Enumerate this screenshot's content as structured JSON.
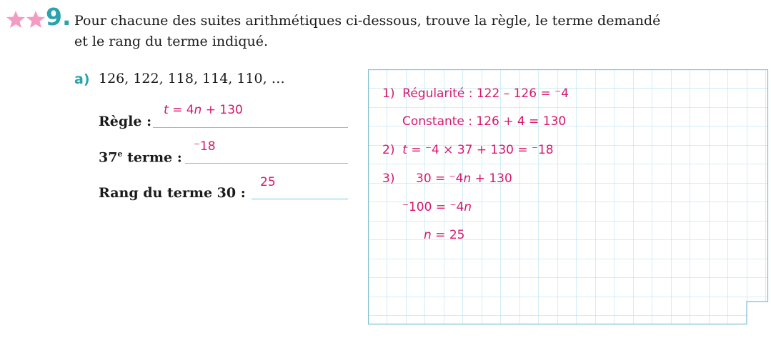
{
  "exercise": {
    "number": "9.",
    "difficulty_stars": 2,
    "star_color": "#f49bc3",
    "accent_color": "#2aa3ad",
    "instruction_line1": "Pour chacune des suites arithmétiques ci-dessous, trouve la règle, le terme demandé",
    "instruction_line2": "et le rang du terme indiqué."
  },
  "part_a": {
    "label": "a)",
    "sequence": "126, 122, 118, 114, 110, …",
    "rule_label": "Règle :",
    "rule_answer": {
      "t": "t",
      "eq": " = 4",
      "n": "n",
      "rest": " + 130"
    },
    "term_label_num": "37",
    "term_label_sup": "e",
    "term_label_rest": " terme :",
    "term_answer": "⁻18",
    "rank_label": "Rang du terme 30 :",
    "rank_answer": "25"
  },
  "work": {
    "line1_num": "1)",
    "line1_text": "Régularité : 122 – 126 = ⁻4",
    "line2_text": "Constante : 126 + 4 = 130",
    "line3_num": "2)",
    "line3_t": "t",
    "line3_rest": " = ⁻4 × 37 + 130 = ⁻18",
    "line4_num": "3)",
    "line4_a": "30 = ⁻4",
    "line4_n": "n",
    "line4_b": " + 130",
    "line5_a": "⁻100 = ⁻4",
    "line5_n": "n",
    "line6_n": "n",
    "line6_b": " = 25"
  },
  "colors": {
    "answer": "#d6186f",
    "grid": "#aadcec",
    "grid_border": "#7bbfd3",
    "underline": "#6fc6e8"
  }
}
